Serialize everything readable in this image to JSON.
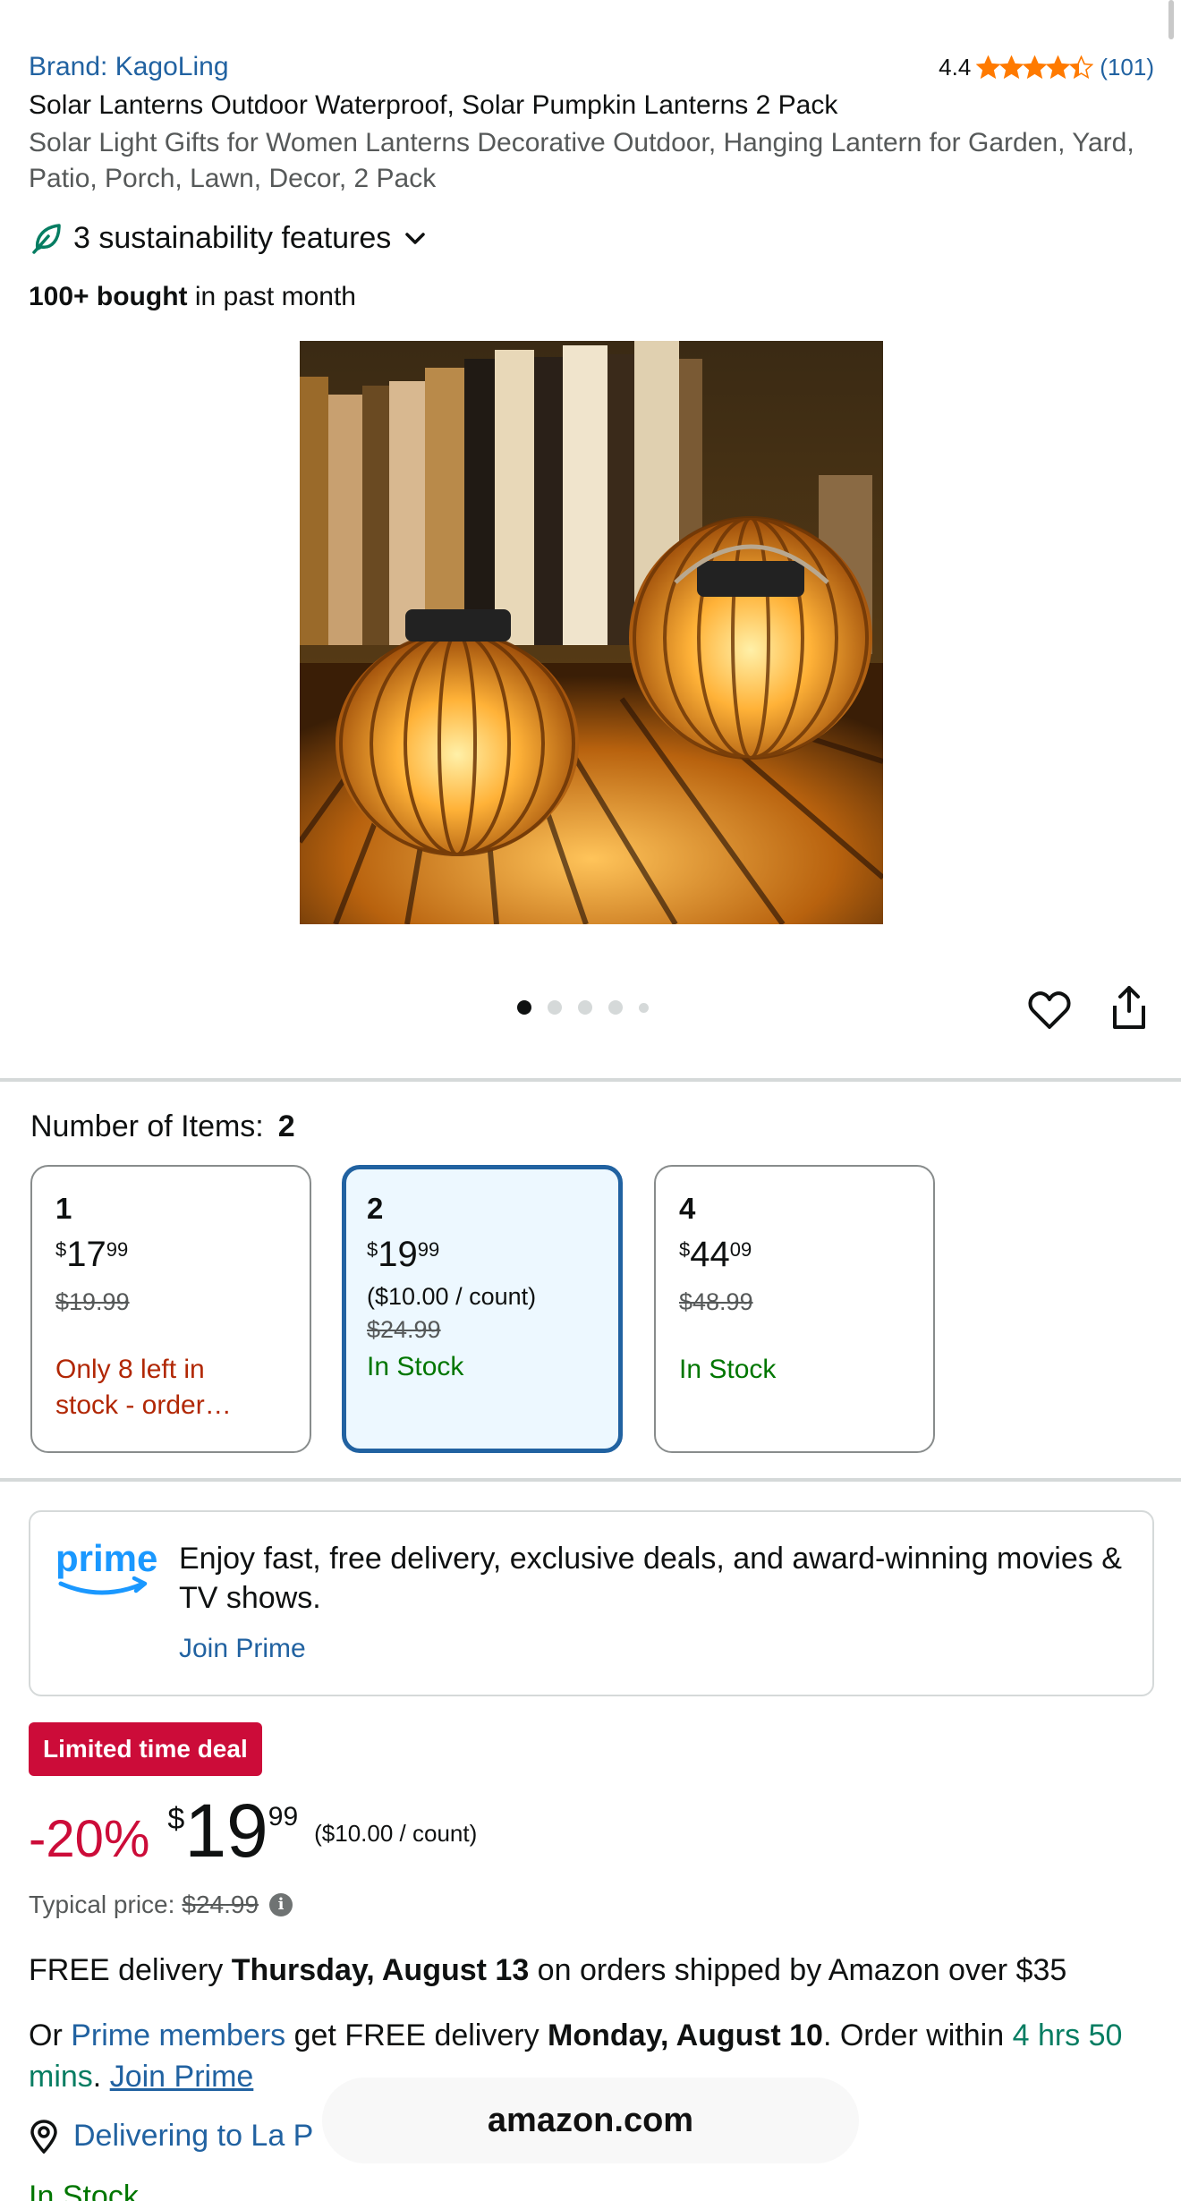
{
  "product": {
    "brand": "Brand: KagoLing",
    "rating": "4.4",
    "review_count": "(101)",
    "stars": 4.4,
    "title": "Solar Lanterns Outdoor Waterproof, Solar Pumpkin Lanterns 2 Pack",
    "subtitle": "Solar Light Gifts for Women Lanterns Decorative Outdoor, Hanging Lantern for Garden, Yard, Patio, Porch, Lawn, Decor, 2 Pack",
    "sustainability": "3 sustainability features",
    "bought_bold": "100+ bought",
    "bought_rest": " in past month"
  },
  "gallery": {
    "image_icon": "solar-pumpkin-lanterns-photo",
    "dots": 5,
    "active_dot": 1
  },
  "variations": {
    "label": "Number of Items:",
    "selected": "2",
    "options": [
      {
        "qty": "1",
        "sym": "$",
        "whole": "17",
        "frac": "99",
        "unit": "",
        "was": "$19.99",
        "stock": "Only 8 left in stock - order…",
        "stock_type": "low"
      },
      {
        "qty": "2",
        "sym": "$",
        "whole": "19",
        "frac": "99",
        "unit": "($10.00 / count)",
        "was": "$24.99",
        "stock": "In Stock",
        "stock_type": "in"
      },
      {
        "qty": "4",
        "sym": "$",
        "whole": "44",
        "frac": "09",
        "unit": "",
        "was": "$48.99",
        "stock": "In Stock",
        "stock_type": "in"
      }
    ]
  },
  "prime": {
    "logo_text": "prime",
    "text": "Enjoy fast, free delivery, exclusive deals, and award-winning movies & TV shows.",
    "join": "Join Prime"
  },
  "deal": {
    "badge": "Limited time deal",
    "discount": "-20%",
    "sym": "$",
    "whole": "19",
    "frac": "99",
    "unit": "($10.00 / count)",
    "typical_label": "Typical price:",
    "typical_price": "$24.99"
  },
  "delivery": {
    "line1_a": "FREE delivery ",
    "line1_b": "Thursday, August 13",
    "line1_c": " on orders shipped by Amazon over $35",
    "line2_a": "Or ",
    "line2_link": "Prime members",
    "line2_b": " get FREE delivery ",
    "line2_date": "Monday, August 10",
    "line2_c": ". Order within ",
    "line2_time": "4 hrs 50 mins",
    "line2_d": ". ",
    "line2_join": "Join Prime",
    "location": "Delivering to La P",
    "in_stock": "In Stock"
  },
  "browser": {
    "url": "amazon.com"
  },
  "colors": {
    "link": "#2162a1",
    "deal_red": "#cc0c39",
    "star": "#ff7a00",
    "stock_green": "#007600",
    "low_stock_red": "#b12704",
    "selected_bg": "#edf8ff"
  }
}
